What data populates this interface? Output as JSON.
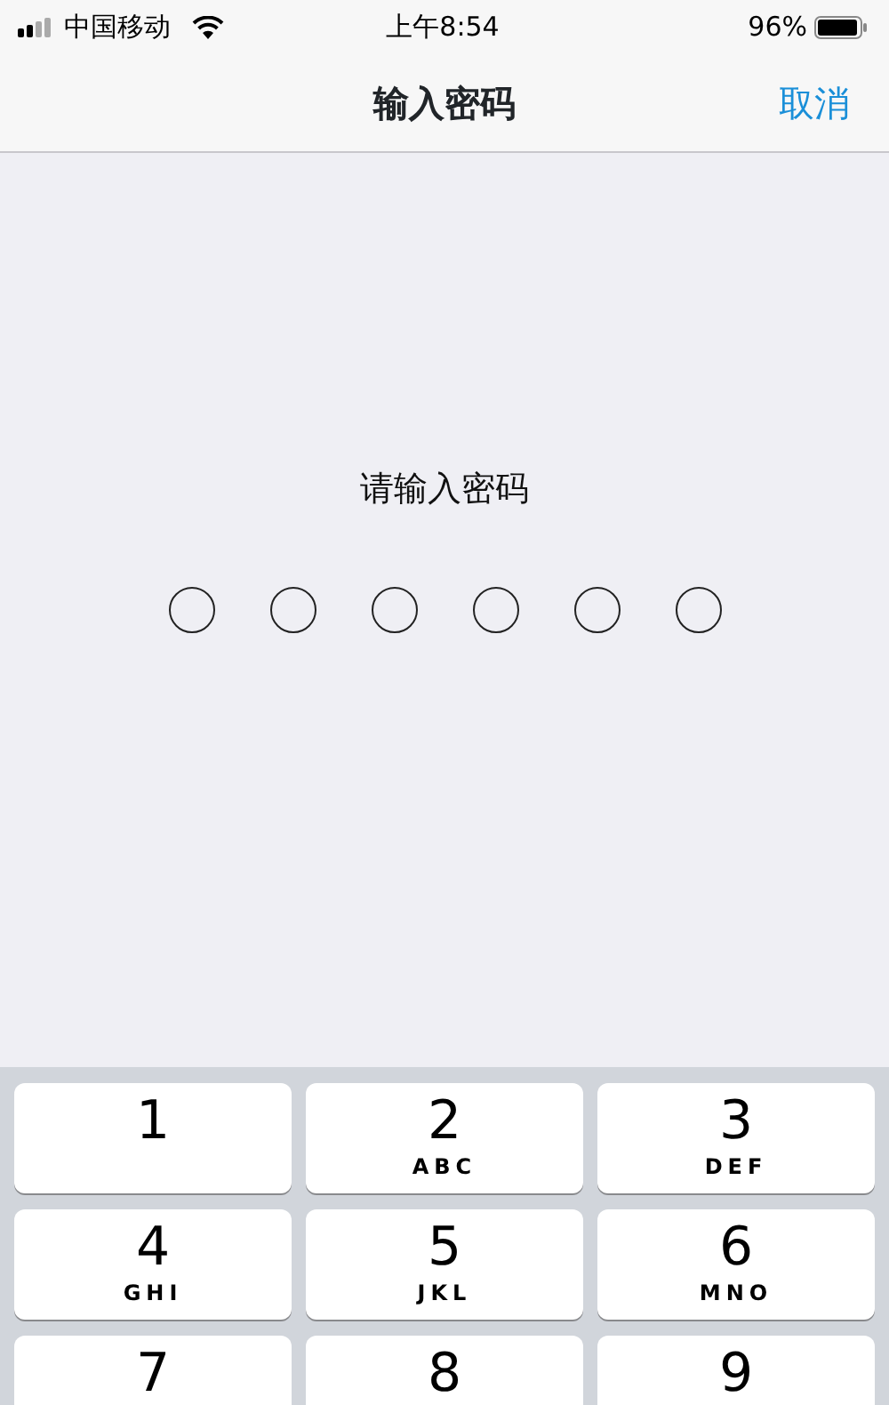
{
  "status_bar": {
    "carrier": "中国移动",
    "time": "上午8:54",
    "battery_text": "96%"
  },
  "nav_bar": {
    "title": "输入密码",
    "cancel": "取消"
  },
  "prompt": "请输入密码",
  "passcode_dots": [
    {
      "filled": false
    },
    {
      "filled": false
    },
    {
      "filled": false
    },
    {
      "filled": false
    },
    {
      "filled": false
    },
    {
      "filled": false
    }
  ],
  "keypad": [
    {
      "digit": "1"
    },
    {
      "digit": "2",
      "letters": "ABC"
    },
    {
      "digit": "3",
      "letters": "DEF"
    },
    {
      "digit": "4",
      "letters": "GHI"
    },
    {
      "digit": "5",
      "letters": "JKL"
    },
    {
      "digit": "6",
      "letters": "MNO"
    },
    {
      "digit": "7"
    },
    {
      "digit": "8"
    },
    {
      "digit": "9"
    }
  ]
}
